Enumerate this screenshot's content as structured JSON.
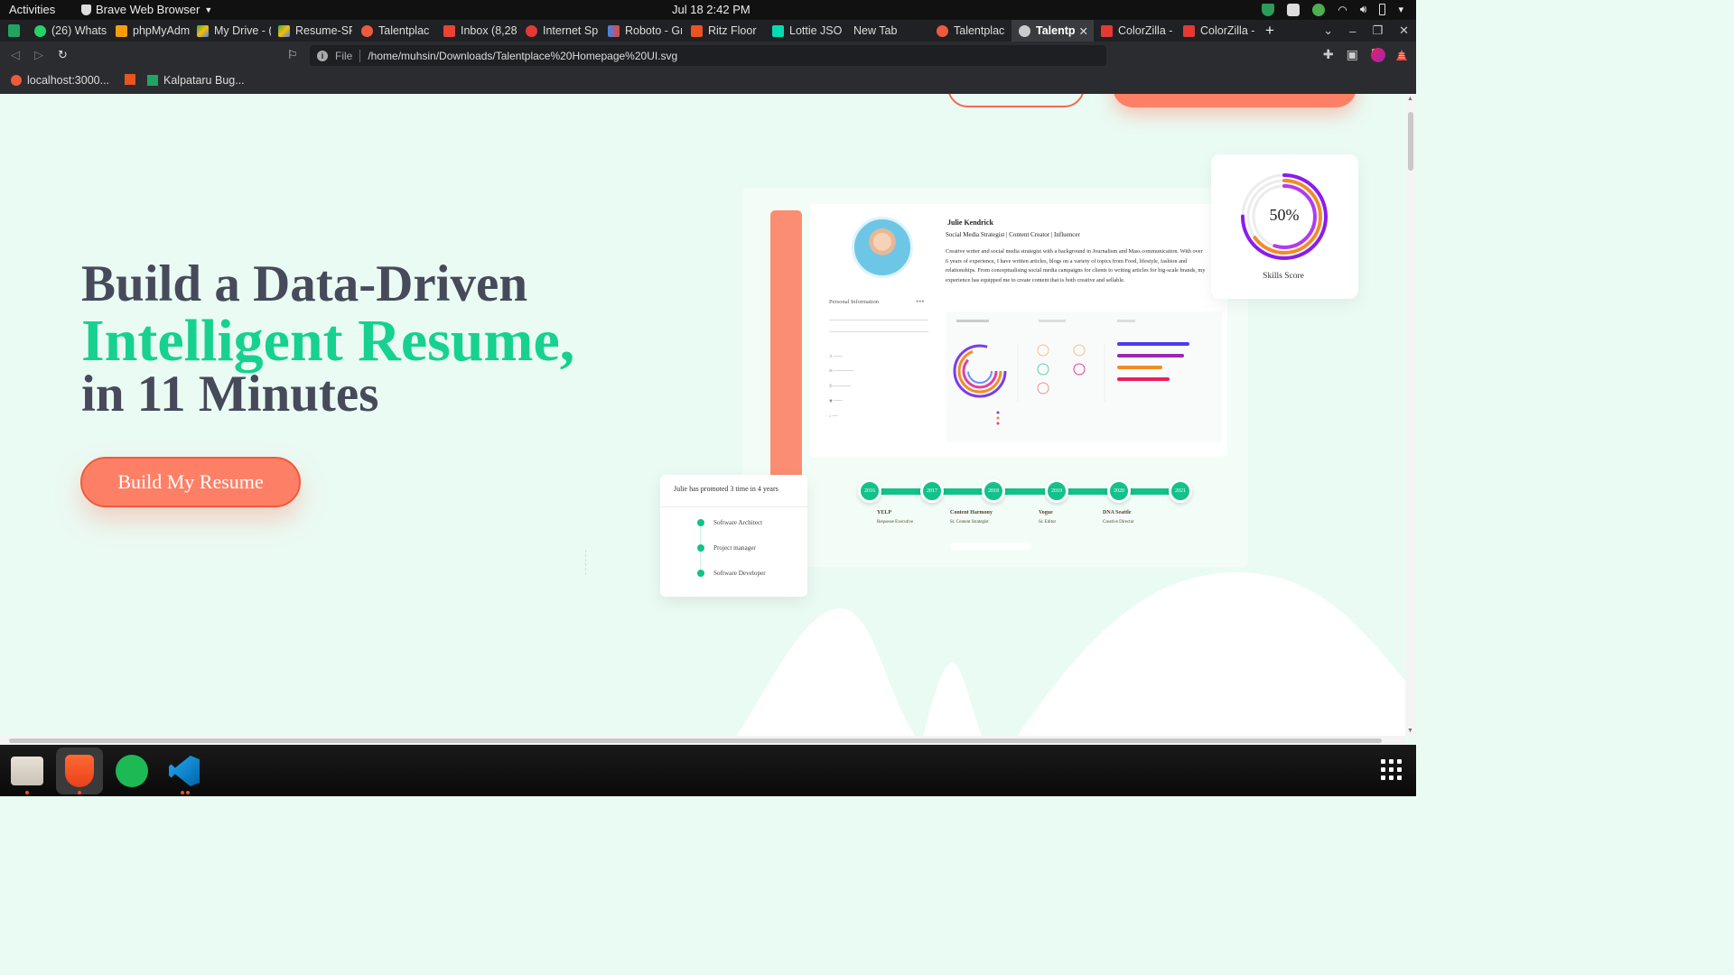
{
  "topbar": {
    "activities": "Activities",
    "app_name": "Brave Web Browser",
    "clock": "Jul 18  2:42 PM"
  },
  "tabs": [
    {
      "label": "(26) Whats",
      "color": "#25d366"
    },
    {
      "label": "phpMyAdm",
      "color": "#f89c0e"
    },
    {
      "label": "My Drive - (",
      "color": "#34a853"
    },
    {
      "label": "Resume-SF",
      "color": "#fbbc04"
    },
    {
      "label": "Talentplac",
      "color": "#f05a3c"
    },
    {
      "label": "Inbox (8,28",
      "color": "#ea4335"
    },
    {
      "label": "Internet Sp",
      "color": "#e53935"
    },
    {
      "label": "Roboto - Gr",
      "color": "#4285f4"
    },
    {
      "label": "Ritz Floor",
      "color": "#e95420"
    },
    {
      "label": "Lottie JSO",
      "color": "#00ddb3"
    },
    {
      "label": "New Tab",
      "color": ""
    },
    {
      "label": "Talentplac",
      "color": "#f05a3c"
    },
    {
      "label": "Talentp",
      "color": "#cccccc",
      "active": true
    },
    {
      "label": "ColorZilla -",
      "color": "#e53935"
    },
    {
      "label": "ColorZilla -",
      "color": "#e53935"
    }
  ],
  "address_bar": {
    "scheme": "File",
    "url": "/home/muhsin/Downloads/Talentplace%20Homepage%20UI.svg"
  },
  "bookmarks": [
    {
      "label": "localhost:3000..."
    },
    {
      "label": ""
    },
    {
      "label": "Kalpataru Bug..."
    }
  ],
  "hero": {
    "line1": "Build a Data-Driven",
    "line2": "Intelligent Resume,",
    "line3": "in 11 Minutes",
    "cta": "Build My Resume"
  },
  "mockup": {
    "name": "Julie Kendrick",
    "role": "Social Media Strategist | Content Creator | Influencer",
    "bio": "Creative writer and social media strategist with a background in Journalism and Mass communication. With over 6 years of experience, I have written articles, blogs on a variety of topics from Food, lifestyle, fashion and relationships. From conceptualising social media campaigns for clients to writing articles for big-scale brands, my experience has equipped me to create content that is both creative and sellable.",
    "personal_info": "Personal Information",
    "timeline_years": [
      "2016",
      "2017",
      "2018",
      "2019",
      "2020",
      "2021"
    ],
    "timeline_blocks": [
      {
        "company": "YELP",
        "title": "Requesse Executive",
        "color": "#c9a6f2"
      },
      {
        "company": "Content Harmony",
        "title": "Sr. Content Strategist",
        "color": "#f5a8d6"
      },
      {
        "company": "Vogue",
        "title": "Sr. Editor",
        "color": "#f9cca0"
      },
      {
        "company": "DNA Seattle",
        "title": "Creative Director",
        "color": "#9fdea6"
      }
    ]
  },
  "promo_card": {
    "title": "Julie has promoted 3 time in 4 years",
    "items": [
      "Software Architect",
      "Project manager",
      "Software Developer"
    ]
  },
  "skills_card": {
    "percent": "50%",
    "label": "Skills Score",
    "value": 0.5
  },
  "colors": {
    "accent_green": "#17d18f",
    "accent_coral": "#fd8066",
    "heading_dark": "#464a5a",
    "page_bg": "#eafbf4"
  }
}
